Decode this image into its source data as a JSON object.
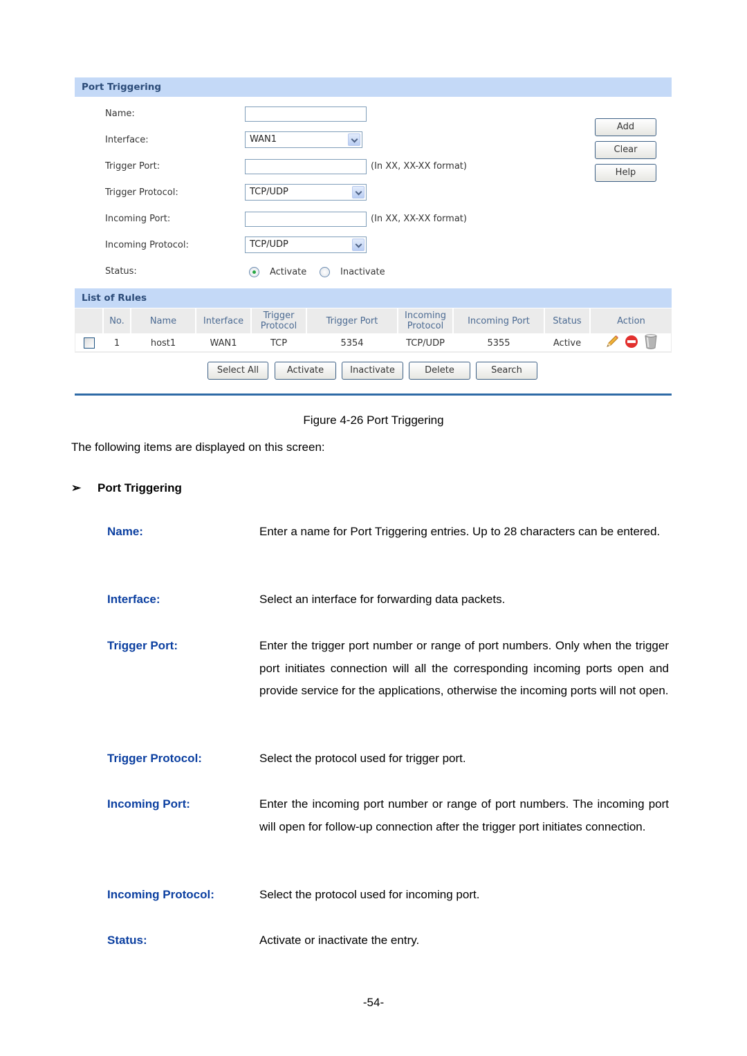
{
  "ui": {
    "section_port_triggering": "Port Triggering",
    "form": {
      "name_label": "Name:",
      "name_value": "",
      "interface_label": "Interface:",
      "interface_value": "WAN1",
      "trigger_port_label": "Trigger Port:",
      "trigger_port_value": "",
      "trigger_port_hint": "(In XX, XX-XX format)",
      "trigger_protocol_label": "Trigger Protocol:",
      "trigger_protocol_value": "TCP/UDP",
      "incoming_port_label": "Incoming Port:",
      "incoming_port_value": "",
      "incoming_port_hint": "(In XX, XX-XX format)",
      "incoming_protocol_label": "Incoming Protocol:",
      "incoming_protocol_value": "TCP/UDP",
      "status_label": "Status:",
      "status_options": [
        "Activate",
        "Inactivate"
      ],
      "status_selected": "Activate"
    },
    "side_buttons": {
      "add": "Add",
      "clear": "Clear",
      "help": "Help"
    },
    "section_list_of_rules": "List of Rules",
    "table": {
      "headers": [
        "",
        "No.",
        "Name",
        "Interface",
        "Trigger Protocol",
        "Trigger Port",
        "Incoming Protocol",
        "Incoming Port",
        "Status",
        "Action"
      ],
      "rows": [
        {
          "checked": false,
          "no": "1",
          "name": "host1",
          "interface": "WAN1",
          "trigger_protocol": "TCP",
          "trigger_port": "5354",
          "incoming_protocol": "TCP/UDP",
          "incoming_port": "5355",
          "status": "Active",
          "actions": [
            "edit-pencil-icon",
            "disable-icon",
            "delete-trash-icon"
          ]
        }
      ]
    },
    "bottom_buttons": {
      "select_all": "Select All",
      "activate": "Activate",
      "inactivate": "Inactivate",
      "delete": "Delete",
      "search": "Search"
    }
  },
  "doc": {
    "caption": "Figure 4-26 Port Triggering",
    "intro": "The following items are displayed on this screen:",
    "subhead": "Port Triggering",
    "subhead_bullet": "➢",
    "items": [
      {
        "term": "Name:",
        "desc": "Enter a name for Port Triggering entries. Up to 28 characters can be entered."
      },
      {
        "term": "Interface:",
        "desc": "Select an interface for forwarding data packets."
      },
      {
        "term": "Trigger Port:",
        "desc": "Enter the trigger port number or range of port numbers. Only when the trigger port initiates connection will all the corresponding incoming ports open and provide service for the applications, otherwise the incoming ports will not open."
      },
      {
        "term": "Trigger Protocol:",
        "desc": "Select the protocol used for trigger port."
      },
      {
        "term": "Incoming Port:",
        "desc": "Enter the incoming port number or range of port numbers. The incoming port will open for follow-up connection after the trigger port initiates connection."
      },
      {
        "term": "Incoming Protocol:",
        "desc": "Select the protocol used for incoming port."
      },
      {
        "term": "Status:",
        "desc": "Activate or inactivate the entry."
      }
    ],
    "page_number": "-54-"
  },
  "colors": {
    "section_bar": "#c4d9f7",
    "term_blue": "#0b3fa0",
    "rule_blue": "#2e6aa6"
  }
}
